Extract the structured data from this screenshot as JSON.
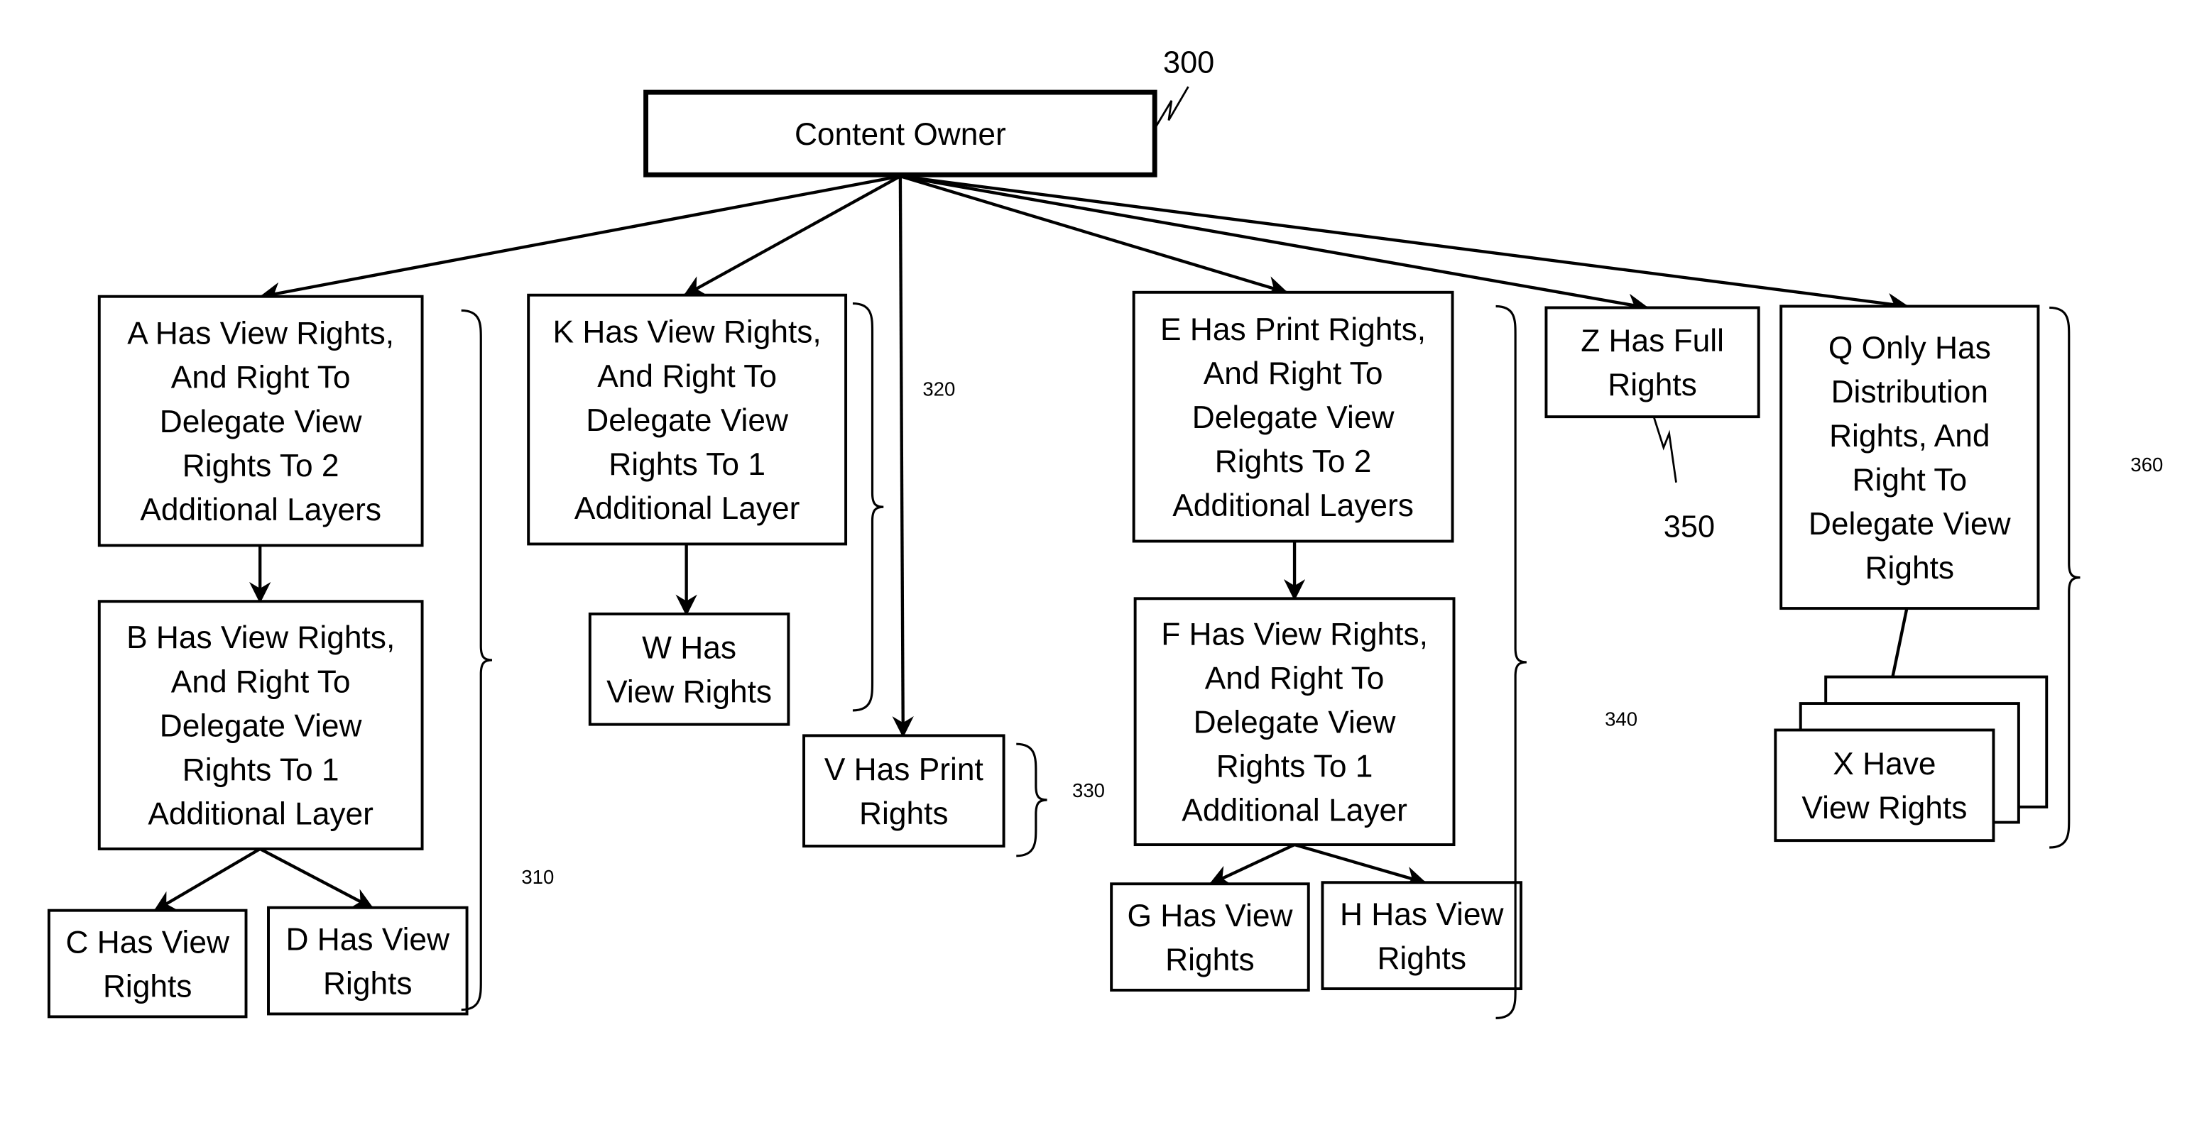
{
  "figure": {
    "root": {
      "id": "content-owner",
      "label": [
        "Content Owner"
      ],
      "ref": "300"
    },
    "nodes": [
      {
        "id": "A",
        "label": [
          "A Has View Rights,",
          "And Right To",
          "Delegate View",
          "Rights To 2",
          "Additional Layers"
        ]
      },
      {
        "id": "B",
        "label": [
          "B Has View Rights,",
          "And Right To",
          "Delegate View",
          "Rights To 1",
          "Additional Layer"
        ]
      },
      {
        "id": "C",
        "label": [
          "C Has View",
          "Rights"
        ]
      },
      {
        "id": "D",
        "label": [
          "D Has View",
          "Rights"
        ]
      },
      {
        "id": "K",
        "label": [
          "K Has View Rights,",
          "And Right To",
          "Delegate View",
          "Rights To 1",
          "Additional Layer"
        ]
      },
      {
        "id": "W",
        "label": [
          "W Has",
          "View Rights"
        ]
      },
      {
        "id": "V",
        "label": [
          "V Has Print",
          "Rights"
        ]
      },
      {
        "id": "E",
        "label": [
          "E Has Print Rights,",
          "And Right To",
          "Delegate View",
          "Rights To 2",
          "Additional Layers"
        ]
      },
      {
        "id": "F",
        "label": [
          "F Has View Rights,",
          "And Right To",
          "Delegate View",
          "Rights To 1",
          "Additional Layer"
        ]
      },
      {
        "id": "G",
        "label": [
          "G Has View",
          "Rights"
        ]
      },
      {
        "id": "H",
        "label": [
          "H Has View",
          "Rights"
        ]
      },
      {
        "id": "Z",
        "label": [
          "Z Has Full",
          "Rights"
        ]
      },
      {
        "id": "Q",
        "label": [
          "Q Only Has",
          "Distribution",
          "Rights, And",
          "Right To",
          "Delegate View",
          "Rights"
        ]
      },
      {
        "id": "X",
        "label": [
          "X Have",
          "View Rights"
        ],
        "stacked": true
      }
    ],
    "edges": [
      [
        "content-owner",
        "A"
      ],
      [
        "content-owner",
        "K"
      ],
      [
        "content-owner",
        "V"
      ],
      [
        "content-owner",
        "E"
      ],
      [
        "content-owner",
        "Z"
      ],
      [
        "content-owner",
        "Q"
      ],
      [
        "A",
        "B"
      ],
      [
        "B",
        "C"
      ],
      [
        "B",
        "D"
      ],
      [
        "K",
        "W"
      ],
      [
        "E",
        "F"
      ],
      [
        "F",
        "G"
      ],
      [
        "F",
        "H"
      ],
      [
        "Q",
        "X"
      ]
    ],
    "groups": [
      {
        "ref": "310",
        "members": [
          "A",
          "B",
          "C",
          "D"
        ]
      },
      {
        "ref": "320",
        "members": [
          "K",
          "W"
        ]
      },
      {
        "ref": "330",
        "members": [
          "V"
        ]
      },
      {
        "ref": "340",
        "members": [
          "E",
          "F",
          "G",
          "H"
        ]
      },
      {
        "ref": "350",
        "members": [
          "Z"
        ]
      },
      {
        "ref": "360",
        "members": [
          "Q",
          "X"
        ]
      }
    ]
  }
}
